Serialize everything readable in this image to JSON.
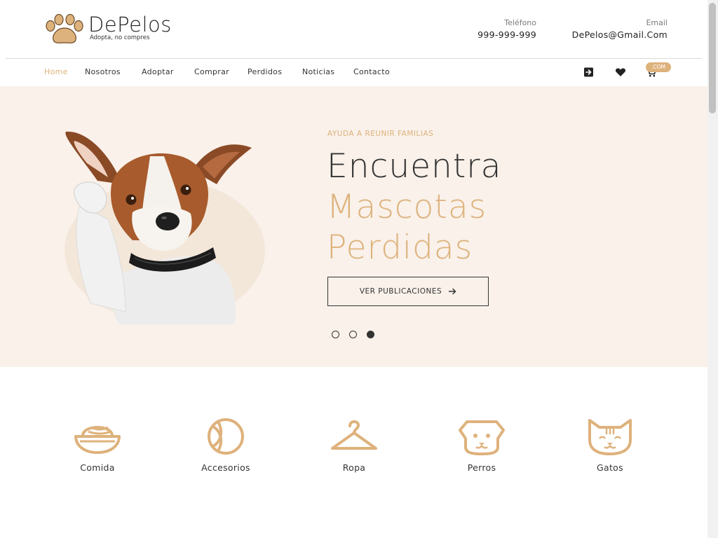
{
  "brand": {
    "name": "DePelos",
    "tagline": "Adopta, no compres",
    "accent": "#deb27c",
    "hero_bg": "#f9f1ea"
  },
  "contact": {
    "phone_label": "Teléfono",
    "phone_value": "999-999-999",
    "email_label": "Email",
    "email_value": "DePelos@Gmail.Com"
  },
  "nav": {
    "items": [
      {
        "label": "Home",
        "active": true
      },
      {
        "label": "Nosotros"
      },
      {
        "label": "Adoptar"
      },
      {
        "label": "Comprar"
      },
      {
        "label": "Perdidos"
      },
      {
        "label": "Noticias"
      },
      {
        "label": "Contacto"
      }
    ],
    "icons": [
      "login-icon",
      "heart-icon",
      "cart-icon"
    ],
    "cart_badge": ".COM"
  },
  "hero": {
    "kicker": "AYUDA A REUNIR FAMILIAS",
    "line1": "Encuentra",
    "line2": "Mascotas",
    "line3": "Perdidas",
    "button_label": "VER PUBLICACIONES",
    "slides_count": 3,
    "active_slide": 3
  },
  "categories": [
    {
      "label": "Comida",
      "icon": "food-bowl-icon"
    },
    {
      "label": "Accesorios",
      "icon": "ball-icon"
    },
    {
      "label": "Ropa",
      "icon": "hanger-icon"
    },
    {
      "label": "Perros",
      "icon": "dog-face-icon"
    },
    {
      "label": "Gatos",
      "icon": "cat-face-icon"
    }
  ]
}
